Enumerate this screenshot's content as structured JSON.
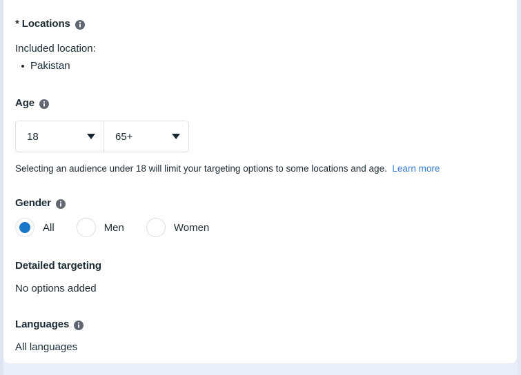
{
  "sections": {
    "locations": {
      "heading": "* Locations",
      "info_icon": "info-icon",
      "included_label": "Included location:",
      "items": [
        "Pakistan"
      ]
    },
    "age": {
      "heading": "Age",
      "info_icon": "info-icon",
      "min_value": "18",
      "max_value": "65+",
      "caret_icon": "chevron-down-icon",
      "note_text": "Selecting an audience under 18 will limit your targeting options to some locations and age.",
      "note_link": "Learn more"
    },
    "gender": {
      "heading": "Gender",
      "info_icon": "info-icon",
      "options": [
        {
          "label": "All",
          "selected": true
        },
        {
          "label": "Men",
          "selected": false
        },
        {
          "label": "Women",
          "selected": false
        }
      ]
    },
    "detailed_targeting": {
      "heading": "Detailed targeting",
      "value": "No options added"
    },
    "languages": {
      "heading": "Languages",
      "info_icon": "info-icon",
      "value": "All languages"
    }
  },
  "colors": {
    "text": "#1c2b33",
    "link": "#3b7dd8",
    "accent": "#1877c9",
    "border": "#d8dfe6",
    "page_background": "#e9eff8",
    "card_background": "#ffffff",
    "icon_gray": "#606770"
  }
}
